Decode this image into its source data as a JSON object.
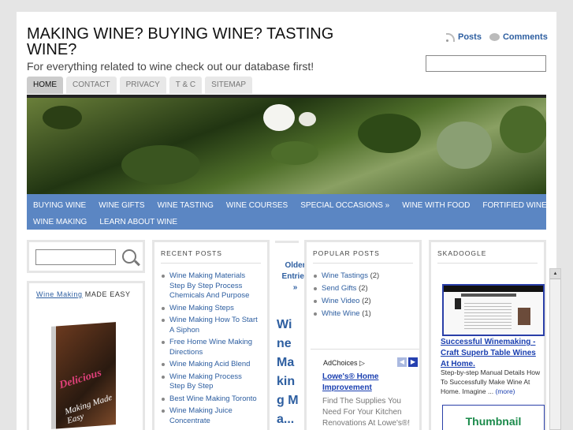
{
  "site": {
    "title": "MAKING WINE? BUYING WINE? TASTING WINE?",
    "tagline": "For everything related to wine check out our database first!"
  },
  "feeds": {
    "posts": "Posts",
    "comments": "Comments"
  },
  "pages": [
    "HOME",
    "CONTACT",
    "PRIVACY",
    "T & C",
    "SITEMAP"
  ],
  "categories_row1": [
    "BUYING WINE",
    "WINE GIFTS",
    "WINE TASTING",
    "WINE COURSES",
    "SPECIAL OCCASIONS »",
    "WINE WITH FOOD",
    "FORTIFIED WINE"
  ],
  "categories_row2": [
    "WINE MAKING",
    "LEARN ABOUT WINE"
  ],
  "sidebar_ad": {
    "link": "Wine Making",
    "rest": " MADE EASY",
    "book_title": "Delicious",
    "book_sub": "Making Made Easy"
  },
  "recent": {
    "heading": "RECENT POSTS",
    "items": [
      "Wine Making Materials Step By Step Process Chemicals And Purpose",
      "Wine Making Steps",
      "Wine Making How To Start A Siphon",
      "Free Home Wine Making Directions",
      "Wine Making Acid Blend",
      "Wine Making Process Step By Step",
      "Best Wine Making Toronto",
      "Wine Making Juice Concentrate"
    ]
  },
  "older": {
    "label": "Older Entries »",
    "big": "Wine Making Ma..."
  },
  "popular": {
    "heading": "POPULAR POSTS",
    "items": [
      {
        "name": "Wine Tastings",
        "count": "(2)"
      },
      {
        "name": "Send Gifts",
        "count": "(2)"
      },
      {
        "name": "Wine Video",
        "count": "(2)"
      },
      {
        "name": "White Wine",
        "count": "(1)"
      }
    ]
  },
  "ad": {
    "choices": "AdChoices",
    "link": "Lowe's® Home Improvement",
    "text": "Find The Supplies You Need For Your Kitchen Renovations At Lowe's®!"
  },
  "skad": {
    "heading": "SKADOOGLE",
    "link": "Successful Winemaking - Craft Superb Table Wines At Home.",
    "text": "Step-by-step Manual Details How To Successfully Make Wine At Home. Imagine ...",
    "more": "(more)",
    "thumb": "Thumbnail"
  }
}
